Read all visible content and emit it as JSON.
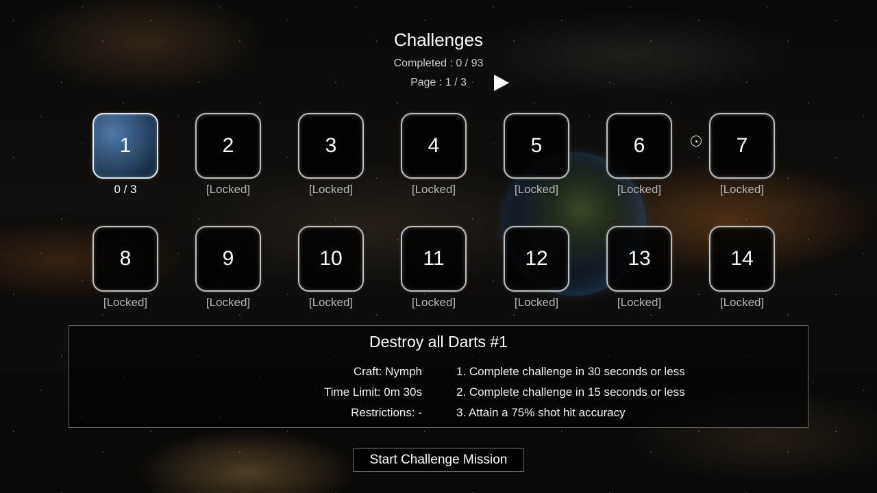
{
  "header": {
    "title": "Challenges",
    "completed": "Completed : 0 / 93",
    "page": "Page : 1 / 3"
  },
  "challenges": [
    {
      "number": "1",
      "status": "0 / 3"
    },
    {
      "number": "2",
      "status": "[Locked]"
    },
    {
      "number": "3",
      "status": "[Locked]"
    },
    {
      "number": "4",
      "status": "[Locked]"
    },
    {
      "number": "5",
      "status": "[Locked]"
    },
    {
      "number": "6",
      "status": "[Locked]"
    },
    {
      "number": "7",
      "status": "[Locked]"
    },
    {
      "number": "8",
      "status": "[Locked]"
    },
    {
      "number": "9",
      "status": "[Locked]"
    },
    {
      "number": "10",
      "status": "[Locked]"
    },
    {
      "number": "11",
      "status": "[Locked]"
    },
    {
      "number": "12",
      "status": "[Locked]"
    },
    {
      "number": "13",
      "status": "[Locked]"
    },
    {
      "number": "14",
      "status": "[Locked]"
    }
  ],
  "details": {
    "title": "Destroy all Darts #1",
    "craft": "Craft: Nymph",
    "time_limit": "Time Limit: 0m 30s",
    "restrictions": "Restrictions: -",
    "goals": [
      "1. Complete challenge in 30 seconds or less",
      "2. Complete challenge in 15 seconds or less",
      "3. Attain a 75% shot hit accuracy"
    ]
  },
  "start_button": "Start Challenge Mission"
}
